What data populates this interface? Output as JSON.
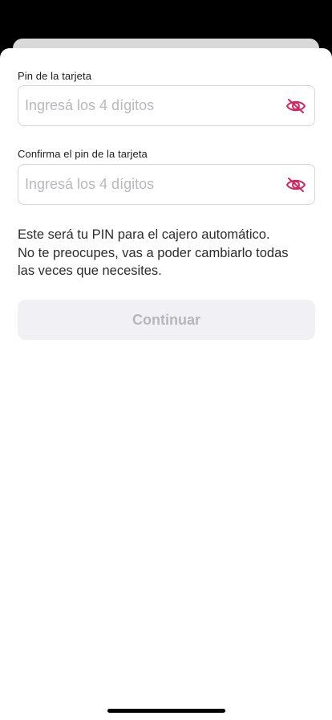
{
  "form": {
    "pin": {
      "label": "Pin de la tarjeta",
      "placeholder": "Ingresá los 4 dígitos",
      "value": ""
    },
    "confirm_pin": {
      "label": "Confirma el pin de la tarjeta",
      "placeholder": "Ingresá los 4 dígitos",
      "value": ""
    }
  },
  "info": {
    "line1": "Este será tu PIN para el cajero automático.",
    "line2": "No te preocupes, vas a poder cambiarlo todas",
    "line3": "las veces que necesites."
  },
  "continue_button": {
    "label": "Continuar",
    "enabled": false
  },
  "icons": {
    "visibility_toggle": "eye-slash-icon"
  },
  "colors": {
    "accent": "#d6245f",
    "button_disabled_bg": "#f1f1f5",
    "button_disabled_text": "#b6b6bc",
    "placeholder": "#b8b8bd",
    "border": "#d6d6da"
  }
}
